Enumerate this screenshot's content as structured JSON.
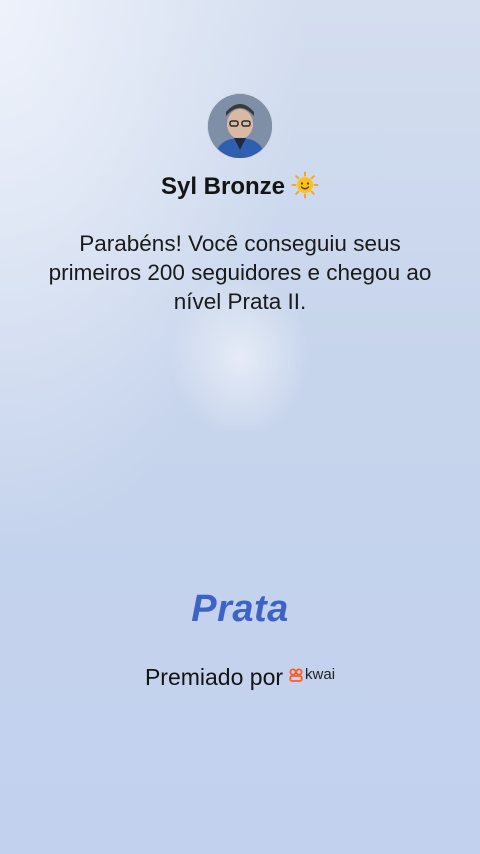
{
  "user": {
    "name": "Syl Bronze",
    "emoji_icon": "sun-face-icon"
  },
  "message": "Parabéns! Você conseguiu seus primeiros 200 seguidores e chegou ao nível Prata II.",
  "level": {
    "title": "Prata"
  },
  "awarded_by": {
    "label": "Premiado por",
    "brand": "kwai"
  },
  "colors": {
    "level_title": "#3e63c7",
    "brand": "#ff5a1f"
  }
}
